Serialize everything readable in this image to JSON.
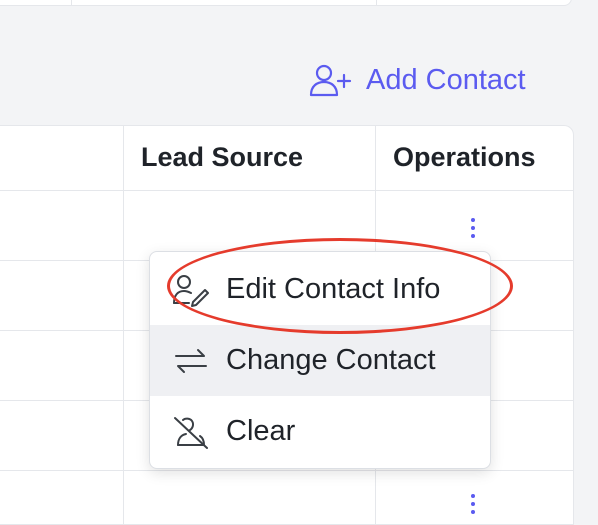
{
  "actions": {
    "add_contact_label": "Add Contact"
  },
  "table": {
    "columns": [
      {
        "key": "lead_source",
        "label": "Lead Source"
      },
      {
        "key": "operations",
        "label": "Operations"
      }
    ]
  },
  "menu": {
    "items": [
      {
        "label": "Edit Contact Info",
        "icon": "user-edit-icon"
      },
      {
        "label": "Change Contact",
        "icon": "swap-arrows-icon"
      },
      {
        "label": "Clear",
        "icon": "user-clear-icon"
      }
    ],
    "active_item": "Change Contact"
  },
  "colors": {
    "accent": "#5b5bf0",
    "annotation": "#e53b2c",
    "menu_hover": "#eff0f3",
    "background": "#f3f4f6"
  }
}
